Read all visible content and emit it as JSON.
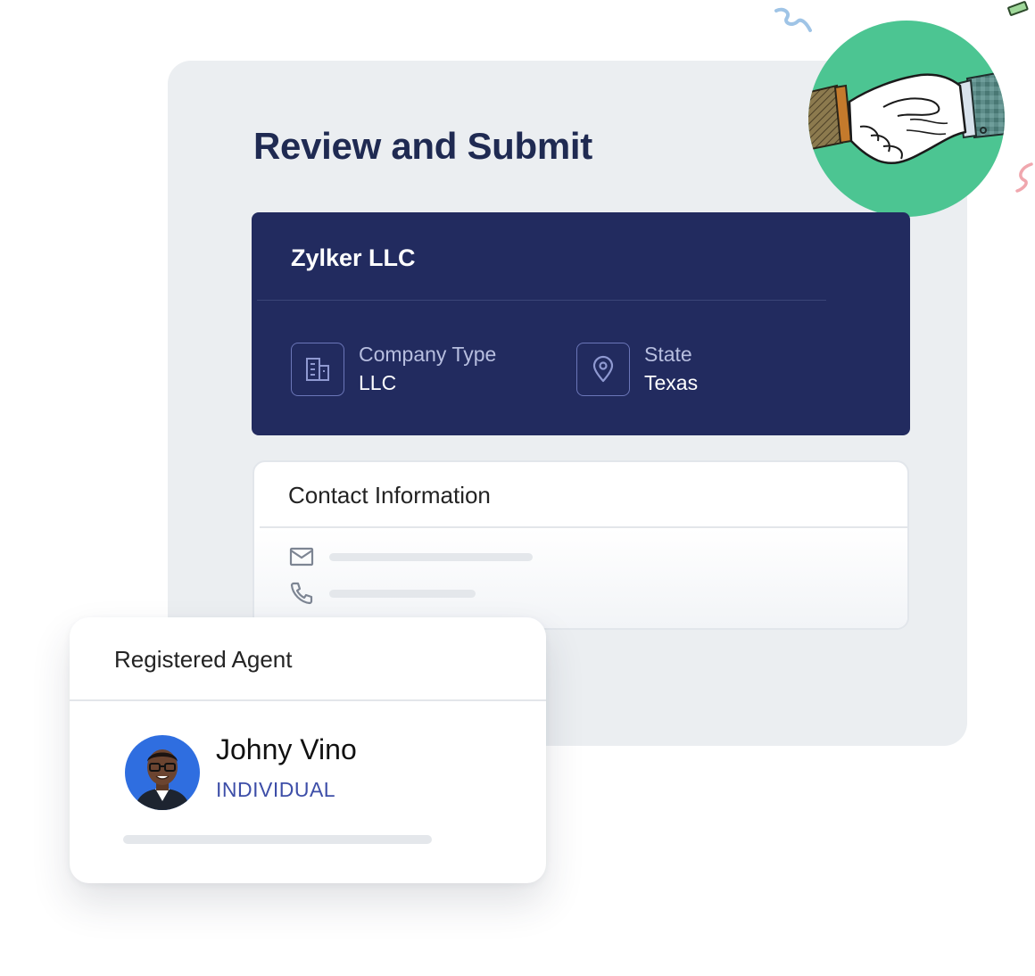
{
  "page": {
    "title": "Review and Submit"
  },
  "company": {
    "name": "Zylker LLC",
    "type_label": "Company Type",
    "type_value": "LLC",
    "state_label": "State",
    "state_value": "Texas"
  },
  "contact": {
    "title": "Contact Information"
  },
  "agent": {
    "section_title": "Registered Agent",
    "name": "Johny Vino",
    "type": "INDIVIDUAL"
  },
  "colors": {
    "navy": "#222b5f",
    "accent_blue": "#3d4ea8",
    "green_circle": "#4cc592",
    "panel_bg": "#ebeef1"
  },
  "icons": [
    "building-icon",
    "location-pin-icon",
    "mail-icon",
    "phone-icon",
    "handshake-illustration",
    "avatar-photo"
  ]
}
